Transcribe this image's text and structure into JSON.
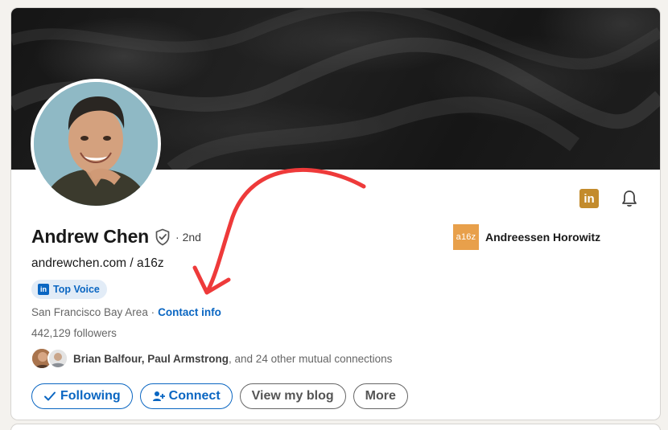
{
  "profile": {
    "name": "Andrew Chen",
    "degree": "· 2nd",
    "headline": "andrewchen.com / a16z",
    "badge_icon": "in",
    "badge": "Top Voice",
    "location": "San Francisco Bay Area ·",
    "contact_info": "Contact info",
    "followers": "442,129 followers"
  },
  "mutual": {
    "names": "Brian Balfour, Paul Armstrong",
    "rest": ", and 24 other mutual connections"
  },
  "company": {
    "logo_text": "a16z",
    "name": "Andreessen Horowitz"
  },
  "top_icons": {
    "linkedin_icon": "in"
  },
  "actions": {
    "following": "Following",
    "connect": "Connect",
    "view_blog": "View my blog",
    "more": "More"
  },
  "colors": {
    "accent": "#0a66c2",
    "annotation_arrow": "#ee3a3a",
    "company_logo": "#e8a04b",
    "linkedin_premium": "#c38b2c"
  },
  "icons": [
    "verified-shield-icon",
    "linkedin-icon",
    "bell-icon",
    "checkmark-icon",
    "add-person-icon"
  ]
}
